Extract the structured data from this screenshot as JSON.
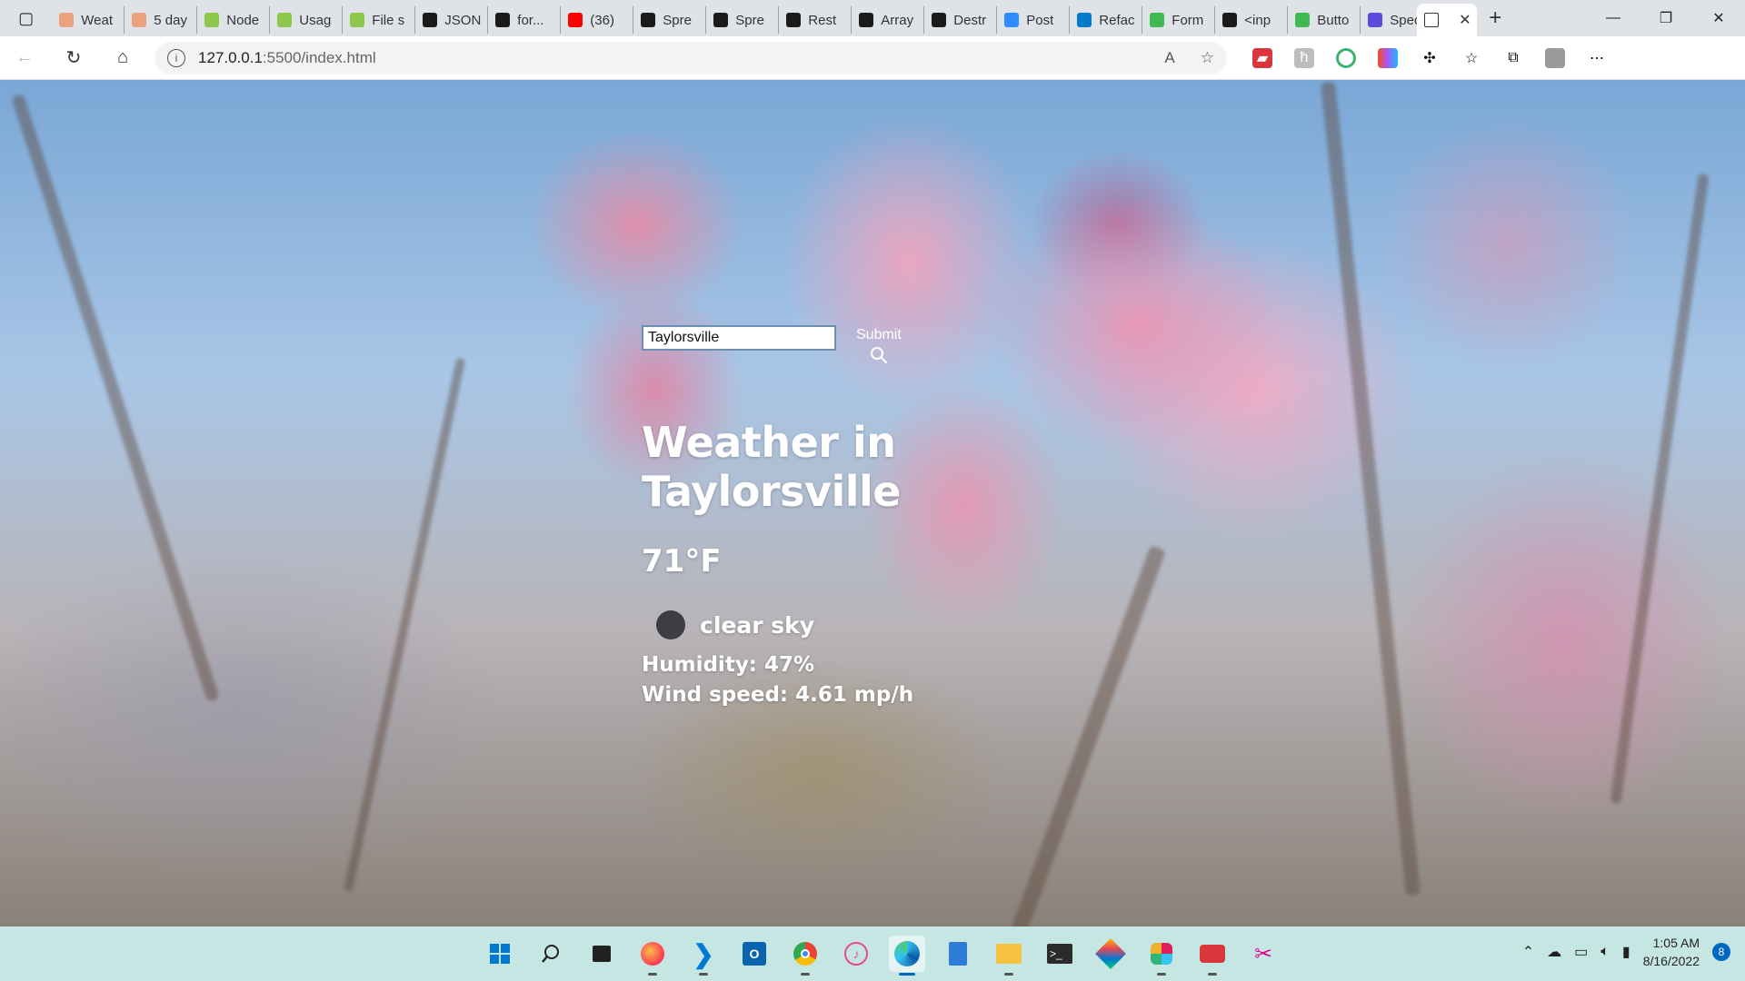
{
  "browser": {
    "tabs": [
      {
        "title": "Weat",
        "icon": "weather-app-icon",
        "color": "#e8a27d"
      },
      {
        "title": "5 day",
        "icon": "weather-app-icon",
        "color": "#e8a27d"
      },
      {
        "title": "Node",
        "icon": "nodejs-icon",
        "color": "#8cc84b"
      },
      {
        "title": "Usag",
        "icon": "nodejs-icon",
        "color": "#8cc84b"
      },
      {
        "title": "File s",
        "icon": "nodejs-icon",
        "color": "#8cc84b"
      },
      {
        "title": "JSON",
        "icon": "mdn-icon",
        "color": "#1b1b1b"
      },
      {
        "title": "for...",
        "icon": "mdn-icon",
        "color": "#1b1b1b"
      },
      {
        "title": "(36)",
        "icon": "youtube-icon",
        "color": "#ff0000"
      },
      {
        "title": "Spre",
        "icon": "mdn-icon",
        "color": "#1b1b1b"
      },
      {
        "title": "Spre",
        "icon": "mdn-icon",
        "color": "#1b1b1b"
      },
      {
        "title": "Rest",
        "icon": "mdn-icon",
        "color": "#1b1b1b"
      },
      {
        "title": "Array",
        "icon": "mdn-icon",
        "color": "#1b1b1b"
      },
      {
        "title": "Destr",
        "icon": "mdn-icon",
        "color": "#1b1b1b"
      },
      {
        "title": "Post",
        "icon": "zoom-icon",
        "color": "#2d8cff"
      },
      {
        "title": "Refac",
        "icon": "vscode-icon",
        "color": "#007acc"
      },
      {
        "title": "Form",
        "icon": "codepen-icon",
        "color": "#3fb950"
      },
      {
        "title": "<inp",
        "icon": "mdn-icon",
        "color": "#1b1b1b"
      },
      {
        "title": "Butto",
        "icon": "codepen-icon",
        "color": "#3fb950"
      },
      {
        "title": "Spec",
        "icon": "spec-icon",
        "color": "#5b4bdb"
      }
    ],
    "active_tab": {
      "title": "",
      "icon": "document-icon"
    },
    "new_tab_label": "+",
    "url_host": "127.0.0.1",
    "url_path": ":5500/index.html"
  },
  "weather": {
    "search": {
      "value": "Taylorsville",
      "submit_label": "Submit"
    },
    "title": "Weather in Taylorsville",
    "temperature": "71°F",
    "condition": "clear sky",
    "humidity": "Humidity: 47%",
    "wind": "Wind speed: 4.61 mp/h"
  },
  "taskbar": {
    "time": "1:05 AM",
    "date": "8/16/2022",
    "notifications": "8"
  }
}
